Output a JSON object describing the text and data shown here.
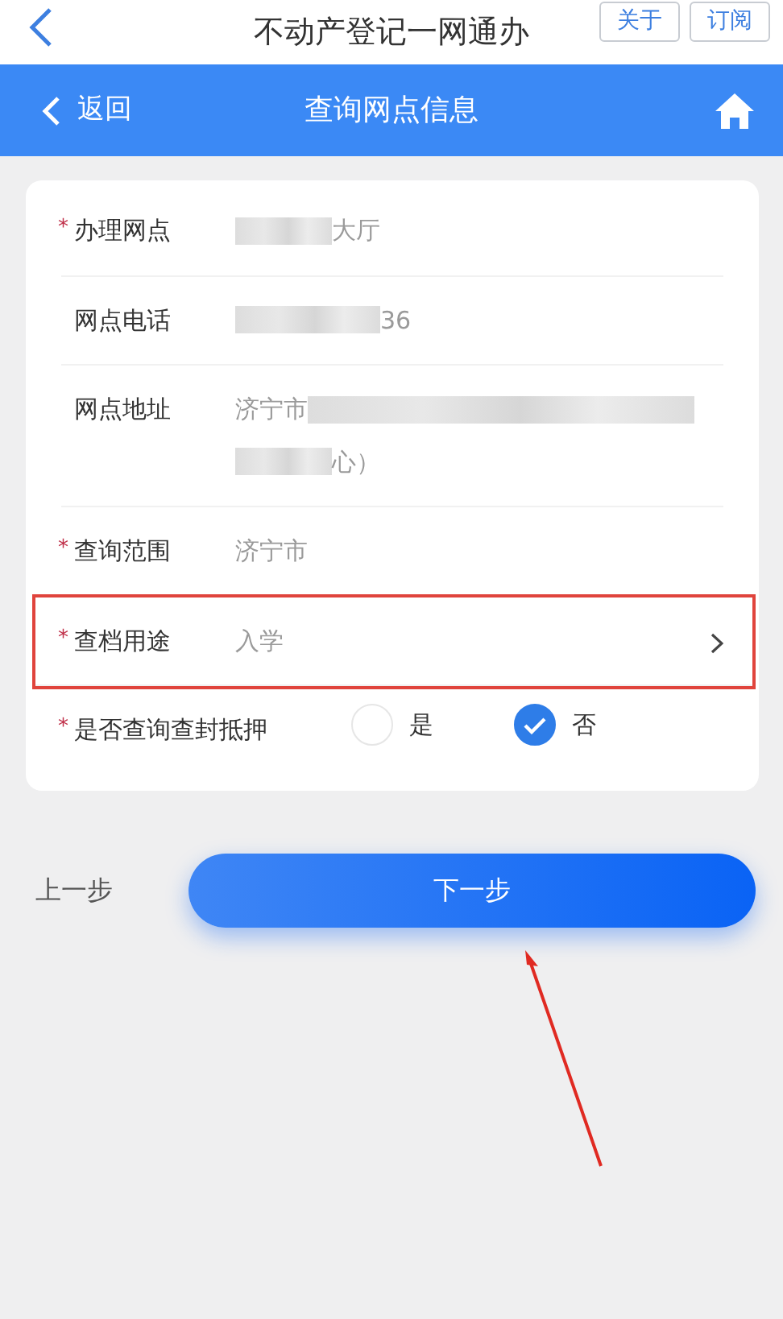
{
  "top_bar": {
    "title": "不动产登记一网通办",
    "buttons": [
      "关于",
      "订阅"
    ]
  },
  "nav_bar": {
    "back": "返回",
    "title": "查询网点信息"
  },
  "form": {
    "rows": [
      {
        "kind": "text",
        "label": "办理网点",
        "required_mark": "*",
        "lines": [
          [
            {
              "kind": "redacted"
            },
            {
              "kind": "text",
              "text": "大厅"
            }
          ]
        ]
      },
      {
        "kind": "text",
        "label": "网点电话",
        "lines": [
          [
            {
              "kind": "redacted"
            },
            {
              "kind": "text",
              "text": "36"
            }
          ]
        ]
      },
      {
        "kind": "text",
        "label": "网点地址",
        "lines": [
          [
            {
              "kind": "text",
              "text": "济宁市"
            },
            {
              "kind": "redacted"
            }
          ],
          [
            {
              "kind": "redacted"
            },
            {
              "kind": "text",
              "text": "心）"
            }
          ]
        ]
      },
      {
        "kind": "text",
        "label": "查询范围",
        "required_mark": "*",
        "lines": [
          [
            {
              "kind": "text",
              "text": "济宁市"
            }
          ]
        ]
      },
      {
        "kind": "select",
        "label": "查档用途",
        "required_mark": "*",
        "highlighted": true,
        "lines": [
          [
            {
              "kind": "text",
              "text": "入学"
            }
          ]
        ]
      },
      {
        "kind": "radio",
        "label": "是否查询查封抵押",
        "required_mark": "*",
        "options": [
          {
            "label": "是",
            "selected": false
          },
          {
            "label": "否",
            "selected": true
          }
        ]
      }
    ]
  },
  "footer": {
    "prev": "上一步",
    "next": "下一步",
    "pointer_arrow": true
  }
}
